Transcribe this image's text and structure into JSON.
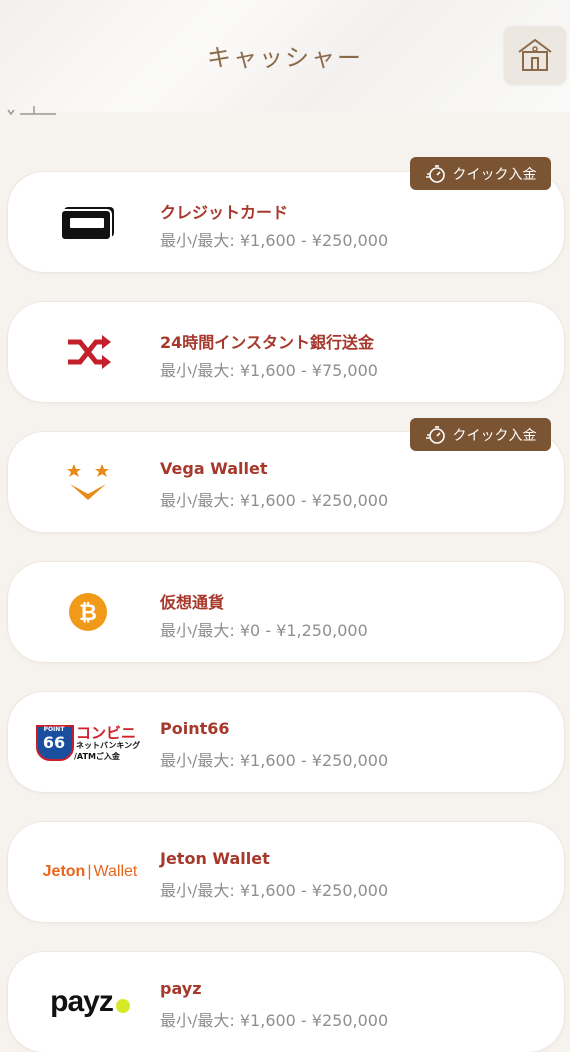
{
  "header": {
    "title": "キャッシャー",
    "home_icon": "home-icon"
  },
  "colors": {
    "brand_brown": "#7a5433",
    "method_name": "#a6382c",
    "range_text": "#8f8f8f"
  },
  "quick_badge_label": "クイック入金",
  "methods": [
    {
      "name": "クレジットカード",
      "range": "最小/最大: ¥1,600 - ¥250,000",
      "icon": "credit-card-icon",
      "quick": true
    },
    {
      "name": "24時間インスタント銀行送金",
      "range": "最小/最大: ¥1,600 - ¥75,000",
      "icon": "shuffle-icon",
      "quick": false
    },
    {
      "name": "Vega Wallet",
      "range": "最小/最大: ¥1,600 - ¥250,000",
      "icon": "vega-wallet-icon",
      "quick": true
    },
    {
      "name": "仮想通貨",
      "range": "最小/最大: ¥0 - ¥1,250,000",
      "icon": "bitcoin-icon",
      "quick": false
    },
    {
      "name": "Point66",
      "range": "最小/最大: ¥1,600 - ¥250,000",
      "icon": "point66-logo",
      "quick": false,
      "logo_text": {
        "badge_top": "POINT",
        "badge_num": "66",
        "main": "コンビニ",
        "sub1": "ネットバンキング",
        "sub2": "/ATMご入金"
      }
    },
    {
      "name": "Jeton Wallet",
      "range": "最小/最大: ¥1,600 - ¥250,000",
      "icon": "jeton-wallet-logo",
      "quick": false,
      "logo_text": {
        "left": "Jeton",
        "right": "Wallet"
      }
    },
    {
      "name": "payz",
      "range": "最小/最大: ¥1,600 - ¥250,000",
      "icon": "payz-logo",
      "quick": false,
      "logo_text": {
        "main": "payz"
      }
    }
  ]
}
